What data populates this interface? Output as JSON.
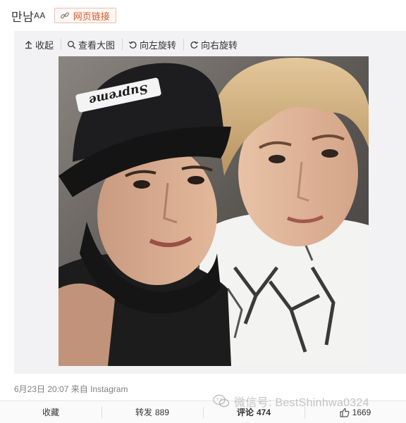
{
  "post": {
    "author": "만남ᴬᴬ",
    "web_link_label": "网页链接"
  },
  "toolbar": {
    "collapse": "收起",
    "view_large": "查看大图",
    "rotate_left": "向左旋转",
    "rotate_right": "向右旋转"
  },
  "image": {
    "cap_text": "Supreme",
    "description_icon": "photo"
  },
  "meta": {
    "timestamp": "6月23日 20:07",
    "source_prefix": "来自",
    "source": "Instagram"
  },
  "actions": {
    "favorite": "收藏",
    "repost_label": "转发",
    "repost_count": "889",
    "comment_label": "评论",
    "comment_count": "474",
    "like_count": "1669"
  },
  "watermark": {
    "text": "微信号: BestShinhwa0324"
  },
  "colors": {
    "accent": "#d35a2c",
    "panel_bg": "#f2f2f5"
  }
}
